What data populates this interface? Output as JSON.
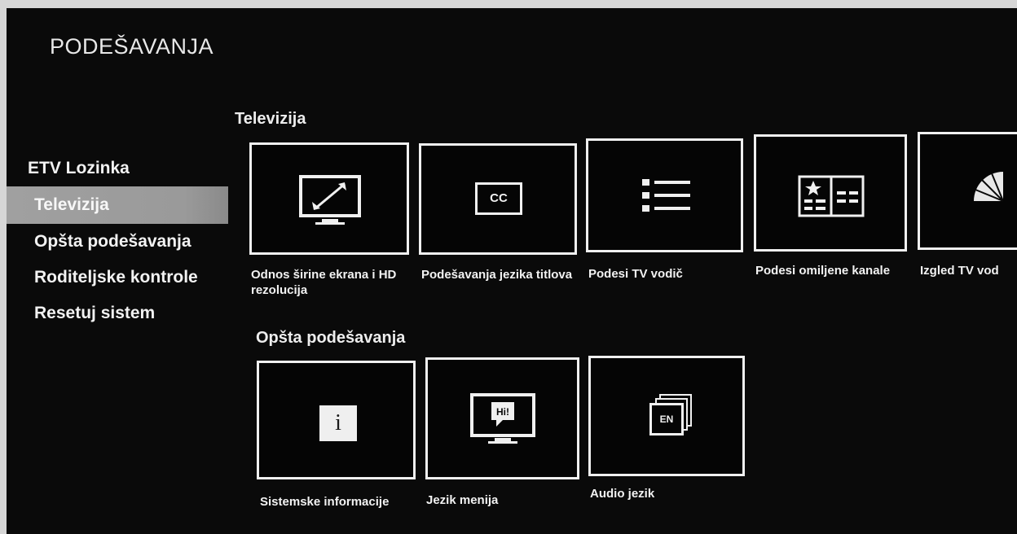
{
  "page_title": "PODEŠAVANJA",
  "sidebar": {
    "items": [
      {
        "label": "ETV Lozinka"
      },
      {
        "label": "Televizija",
        "selected": true
      },
      {
        "label": "Opšta podešavanja"
      },
      {
        "label": "Roditeljske kontrole"
      },
      {
        "label": "Resetuj sistem"
      }
    ]
  },
  "sections": [
    {
      "title": "Televizija",
      "tiles": [
        {
          "label": "Odnos širine ekrana i HD rezolucija",
          "icon": "aspect-ratio-tv-icon"
        },
        {
          "label": "Podešavanja jezika titlova",
          "icon": "closed-captions-icon",
          "icon_text": "CC"
        },
        {
          "label": "Podesi TV vodič",
          "icon": "list-icon"
        },
        {
          "label": "Podesi omiljene kanale",
          "icon": "favorite-channels-icon"
        },
        {
          "label": "Izgled TV vod",
          "icon": "tv-guide-layout-icon"
        }
      ]
    },
    {
      "title": "Opšta podešavanja",
      "tiles": [
        {
          "label": "Sistemske informacije",
          "icon": "info-icon",
          "icon_text": "i"
        },
        {
          "label": "Jezik menija",
          "icon": "menu-language-tv-icon",
          "icon_text": "Hi!"
        },
        {
          "label": "Audio jezik",
          "icon": "audio-language-icon",
          "icon_text": "EN"
        }
      ]
    }
  ],
  "colors": {
    "background": "#0a0a0a",
    "tile_border": "#f0f0f0",
    "selected_item": "#9e9e9e",
    "text": "#f2f2f2"
  }
}
